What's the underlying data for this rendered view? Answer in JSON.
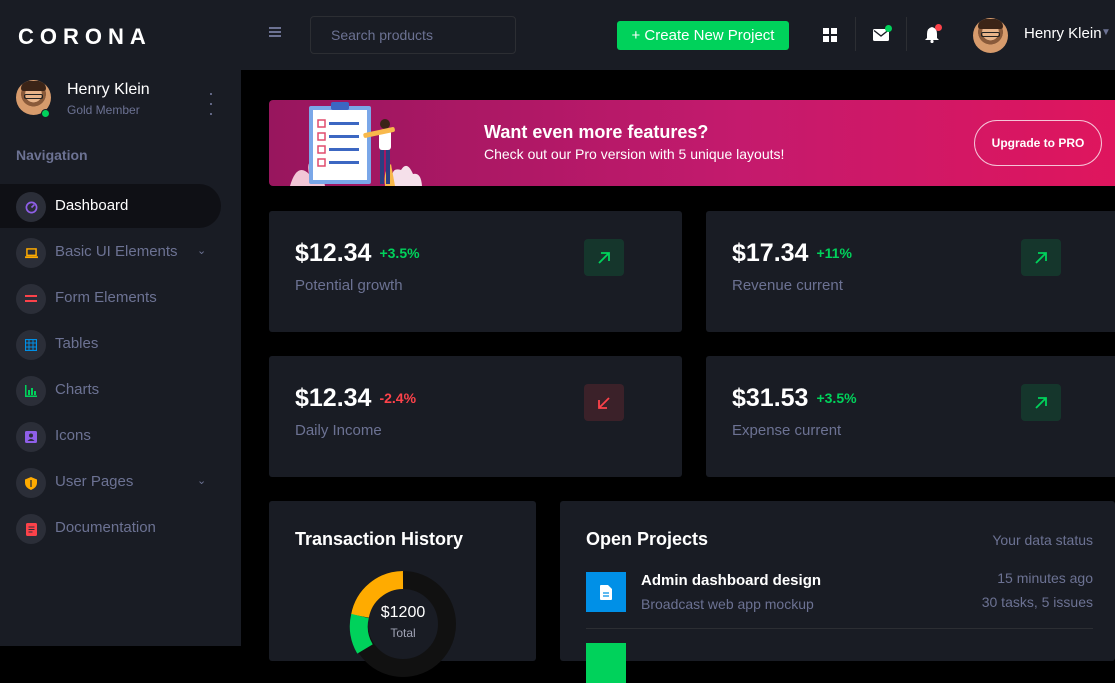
{
  "brand": {
    "name": "CORONA"
  },
  "sidebar": {
    "profile": {
      "name": "Henry Klein",
      "role": "Gold Member"
    },
    "nav_heading": "Navigation",
    "items": [
      {
        "label": "Dashboard",
        "icon": "speedometer-icon",
        "color": "#8f5fe8",
        "active": true
      },
      {
        "label": "Basic UI Elements",
        "icon": "laptop-icon",
        "color": "#ffab00",
        "has_submenu": true
      },
      {
        "label": "Form Elements",
        "icon": "list-icon",
        "color": "#fc424a"
      },
      {
        "label": "Tables",
        "icon": "table-icon",
        "color": "#0090e7"
      },
      {
        "label": "Charts",
        "icon": "chart-bar-icon",
        "color": "#00d25b"
      },
      {
        "label": "Icons",
        "icon": "contacts-icon",
        "color": "#8f5fe8"
      },
      {
        "label": "User Pages",
        "icon": "shield-icon",
        "color": "#ffab00",
        "has_submenu": true
      },
      {
        "label": "Documentation",
        "icon": "file-document-icon",
        "color": "#fc424a"
      }
    ]
  },
  "topbar": {
    "search_placeholder": "Search products",
    "create_button": "+ Create New Project",
    "user_name": "Henry Klein"
  },
  "banner": {
    "title": "Want even more features?",
    "subtitle": "Check out our Pro version with 5 unique layouts!",
    "button": "Upgrade to PRO"
  },
  "stats": [
    {
      "value": "$12.34",
      "change": "+3.5%",
      "label": "Potential growth",
      "trend": "up"
    },
    {
      "value": "$17.34",
      "change": "+11%",
      "label": "Revenue current",
      "trend": "up"
    },
    {
      "value": "$12.34",
      "change": "-2.4%",
      "label": "Daily Income",
      "trend": "down"
    },
    {
      "value": "$31.53",
      "change": "+3.5%",
      "label": "Expense current",
      "trend": "up"
    }
  ],
  "colors": {
    "success": "#00d25b",
    "danger": "#fc424a",
    "warning": "#ffab00",
    "info": "#0090e7",
    "primary": "#8f5fe8"
  },
  "transactions": {
    "title": "Transaction History",
    "total_value": "$1200",
    "total_label": "Total"
  },
  "projects": {
    "title": "Open Projects",
    "status": "Your data status",
    "items": [
      {
        "name": "Admin dashboard design",
        "desc": "Broadcast web app mockup",
        "time": "15 minutes ago",
        "stats": "30 tasks, 5 issues",
        "icon": "file-icon"
      }
    ]
  }
}
